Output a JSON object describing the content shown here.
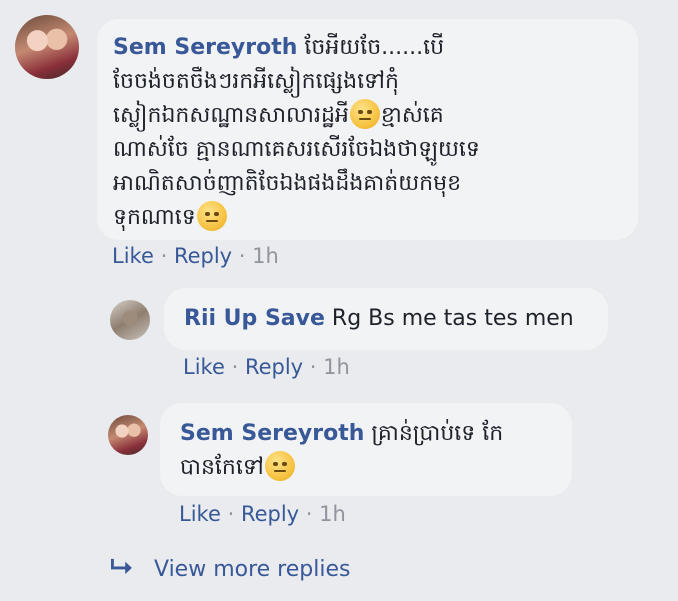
{
  "comments": [
    {
      "author": "Sem Sereyroth",
      "text_lines": [
        "ចែអីយចែ......បើ",
        "ចែចង់ចតចឺងៗរកអីស្លៀកផ្សេងទៅកុំ",
        "ស្លៀកឯកសណ្ឋានសាលារដ្ឋអី",
        "ណាស់ចែ គ្មានណាគេសរសើរចែឯងថាឡូយទេ",
        "អាណិតសាច់ញាតិចែឯងផងដឹងគាត់យកមុខ",
        "ទុកណាទេ"
      ],
      "line3_tail": "ខ្មាស់គេ",
      "like": "Like",
      "reply": "Reply",
      "time": "1h"
    },
    {
      "author": "Rii Up Save",
      "text": "Rg Bs me tas tes men",
      "like": "Like",
      "reply": "Reply",
      "time": "1h"
    },
    {
      "author": "Sem Sereyroth",
      "text_line1": "គ្រាន់ប្រាប់ទេ កែ",
      "text_line2": "បានកែទៅ",
      "like": "Like",
      "reply": "Reply",
      "time": "1h"
    }
  ],
  "view_more": "View more replies",
  "separator": "·",
  "icons": {
    "emoji": "neutral-face-emoji-icon",
    "reply_arrow": "reply-arrow-icon"
  },
  "colors": {
    "link": "#385898",
    "meta": "#90949c",
    "bubble": "#f2f3f5",
    "background": "#e9ebee"
  }
}
